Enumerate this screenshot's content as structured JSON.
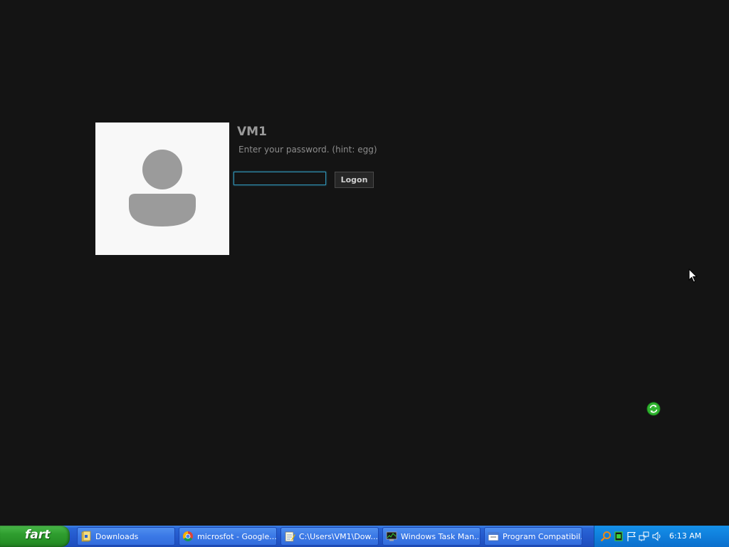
{
  "logon": {
    "user_name": "VM1",
    "password_hint": "Enter your password. (hint: egg)",
    "password_value": "",
    "logon_button_label": "Logon",
    "avatar_icon": "user-silhouette-icon"
  },
  "taskbar": {
    "start_label": "fart",
    "tasks": [
      {
        "label": "Downloads",
        "icon": "folder-icon"
      },
      {
        "label": "microsfot - Google...",
        "icon": "chrome-icon"
      },
      {
        "label": "C:\\Users\\VM1\\Dow...",
        "icon": "notepad-icon"
      },
      {
        "label": "Windows Task Man...",
        "icon": "task-manager-icon"
      },
      {
        "label": "Program Compatibil...",
        "icon": "window-icon"
      }
    ],
    "tray": {
      "icons": [
        "search-icon",
        "green-square-icon",
        "flag-icon",
        "network-icon",
        "speaker-icon"
      ],
      "clock": "6:13 AM"
    }
  },
  "desktop": {
    "sync_icon": "sync-icon",
    "cursor": "mouse-cursor"
  },
  "colors": {
    "background": "#141414",
    "taskbar_blue": "#2459cd",
    "start_green": "#2e9d2e",
    "tray_blue": "#0f7fdc",
    "input_focus": "#2f8fb0"
  }
}
